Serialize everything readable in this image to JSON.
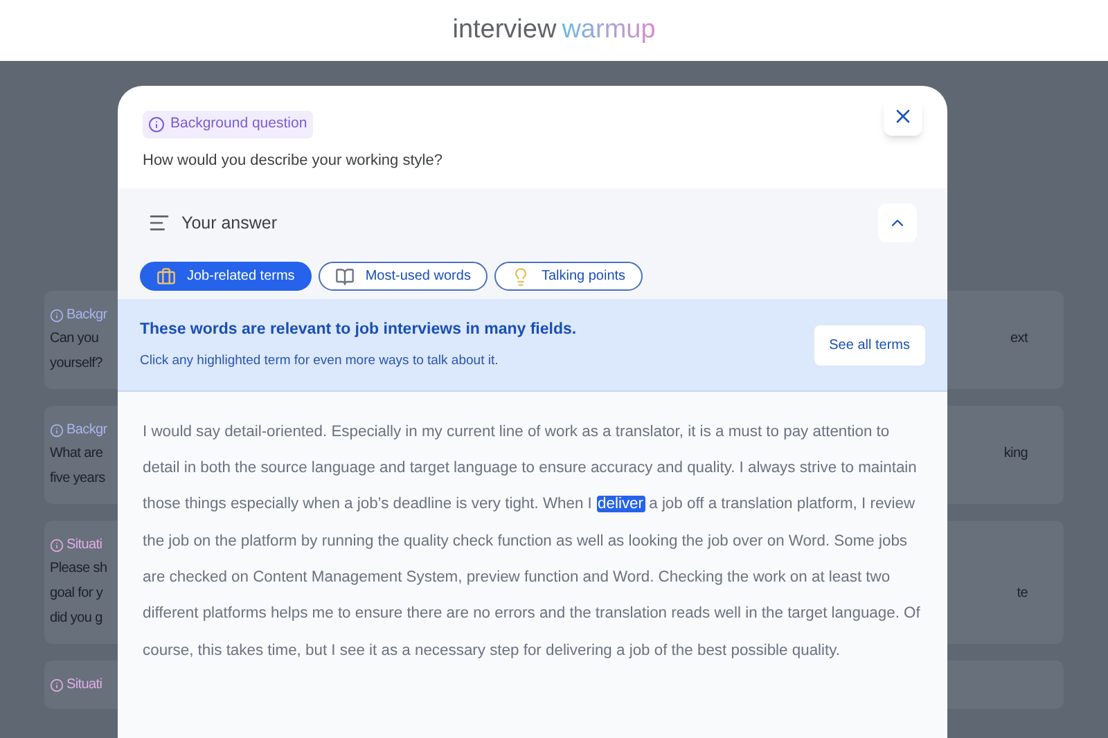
{
  "logo": {
    "first": "interview",
    "second": "warmup"
  },
  "background_cards": [
    {
      "tag": "Backgr",
      "kind": "background",
      "lines": [
        {
          "left": "Can you",
          "right": "ext"
        },
        {
          "left": "yourself?"
        }
      ]
    },
    {
      "tag": "Backgr",
      "kind": "background",
      "lines": [
        {
          "left": "What are",
          "right": "king"
        },
        {
          "left": "five years"
        }
      ]
    },
    {
      "tag": "Situati",
      "kind": "situational",
      "lines": [
        {
          "left": "Please sh"
        },
        {
          "left": "goal for y",
          "right": "te"
        },
        {
          "left": "did you g"
        }
      ]
    },
    {
      "tag": "Situati",
      "kind": "situational"
    }
  ],
  "modal": {
    "tag": "Background question",
    "question": "How would you describe your working style?",
    "answer_header": {
      "title": "Your answer",
      "expanded": true
    },
    "tabs": [
      {
        "label": "Job-related terms",
        "selected": true
      },
      {
        "label": "Most-used words",
        "selected": false
      },
      {
        "label": "Talking points",
        "selected": false
      }
    ],
    "banner": {
      "title": "These words are relevant to job interviews in many fields.",
      "subtitle": "Click any highlighted term for even more ways to talk about it.",
      "button": "See all terms"
    },
    "answer": [
      {
        "text": "I would say detail-oriented. Especially in my current line of work as a translator, it is a must to pay attention to detail in both the source language and target language to ensure accuracy and quality. I always strive to maintain those things especially when a job’s deadline is very tight. When I ",
        "highlighted": false
      },
      {
        "text": "deliver",
        "highlighted": true
      },
      {
        "text": " a job off a translation platform, I review the job on the platform by running the quality check function as well as looking the job over on Word. Some jobs are checked on Content Management System, preview function and Word. Checking the work on at least two different platforms helps me to ensure there are no errors and the translation reads well in the target language. Of course, this takes time, but I see it as a necessary step for delivering a job of the best possible quality.",
        "highlighted": false
      }
    ]
  }
}
